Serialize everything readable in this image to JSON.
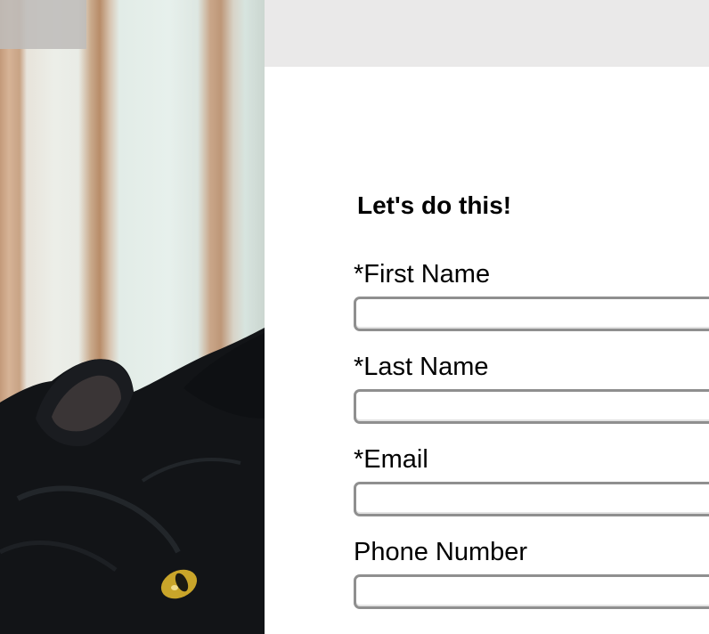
{
  "form": {
    "title": "Let's do this!",
    "fields": [
      {
        "label": "*First Name",
        "value": "",
        "placeholder": ""
      },
      {
        "label": "*Last Name",
        "value": "",
        "placeholder": ""
      },
      {
        "label": "*Email",
        "value": "",
        "placeholder": ""
      },
      {
        "label": "Phone Number",
        "value": "",
        "placeholder": ""
      }
    ]
  },
  "photo": {
    "subject": "black cat"
  },
  "colors": {
    "top_strip": "#eae9e9",
    "input_border": "#8f8f8f",
    "cat_eye": "#c9a52a"
  }
}
